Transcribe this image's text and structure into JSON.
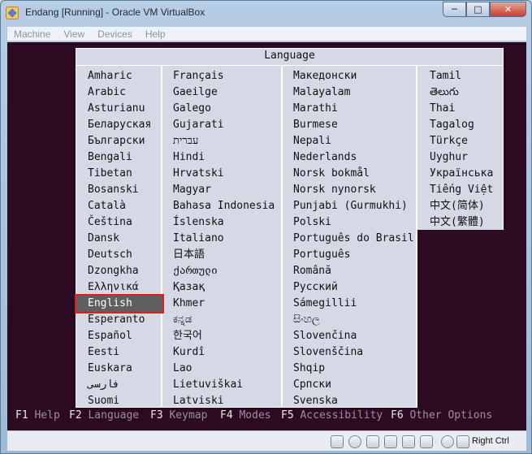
{
  "window": {
    "title": "Endang [Running] - Oracle VM VirtualBox",
    "controls": {
      "minimize": "─",
      "maximize": "□",
      "close": "✕"
    }
  },
  "menubar": [
    "Machine",
    "View",
    "Devices",
    "Help"
  ],
  "dialog": {
    "title": "Language",
    "selected": "English",
    "columns": [
      [
        "Amharic",
        "Arabic",
        "Asturianu",
        "Беларуская",
        "Български",
        "Bengali",
        "Tibetan",
        "Bosanski",
        "Català",
        "Čeština",
        "Dansk",
        "Deutsch",
        "Dzongkha",
        "Ελληνικά",
        "English",
        "Esperanto",
        "Español",
        "Eesti",
        "Euskara",
        "فارسی",
        "Suomi"
      ],
      [
        "Français",
        "Gaeilge",
        "Galego",
        "Gujarati",
        "עברית",
        "Hindi",
        "Hrvatski",
        "Magyar",
        "Bahasa Indonesia",
        "Íslenska",
        "Italiano",
        "日本語",
        "ქართული",
        "Қазақ",
        "Khmer",
        "ಕನ್ನಡ",
        "한국어",
        "Kurdî",
        "Lao",
        "Lietuviškai",
        "Latviski"
      ],
      [
        "Македонски",
        "Malayalam",
        "Marathi",
        "Burmese",
        "Nepali",
        "Nederlands",
        "Norsk bokmål",
        "Norsk nynorsk",
        "Punjabi (Gurmukhi)",
        "Polski",
        "Português do Brasil",
        "Português",
        "Română",
        "Русский",
        "Sámegillii",
        "සිංහල",
        "Slovenčina",
        "Slovenščina",
        "Shqip",
        "Српски",
        "Svenska"
      ],
      [
        "Tamil",
        "తెలుగు",
        "Thai",
        "Tagalog",
        "Türkçe",
        "Uyghur",
        "Українська",
        "Tiếng Việt",
        "中文(简体)",
        "中文(繁體)"
      ]
    ]
  },
  "function_keys": [
    {
      "key": "F1",
      "label": "Help"
    },
    {
      "key": "F2",
      "label": "Language"
    },
    {
      "key": "F3",
      "label": "Keymap"
    },
    {
      "key": "F4",
      "label": "Modes"
    },
    {
      "key": "F5",
      "label": "Accessibility"
    },
    {
      "key": "F6",
      "label": "Other Options"
    }
  ],
  "statusbar": {
    "icons": [
      "hard-disk-icon",
      "optical-drive-icon",
      "usb-icon",
      "shared-folders-icon",
      "network-icon",
      "display-icon",
      "capture-icon",
      "mouse-integration-icon",
      "keyboard-icon"
    ],
    "host_key": "Right Ctrl"
  }
}
